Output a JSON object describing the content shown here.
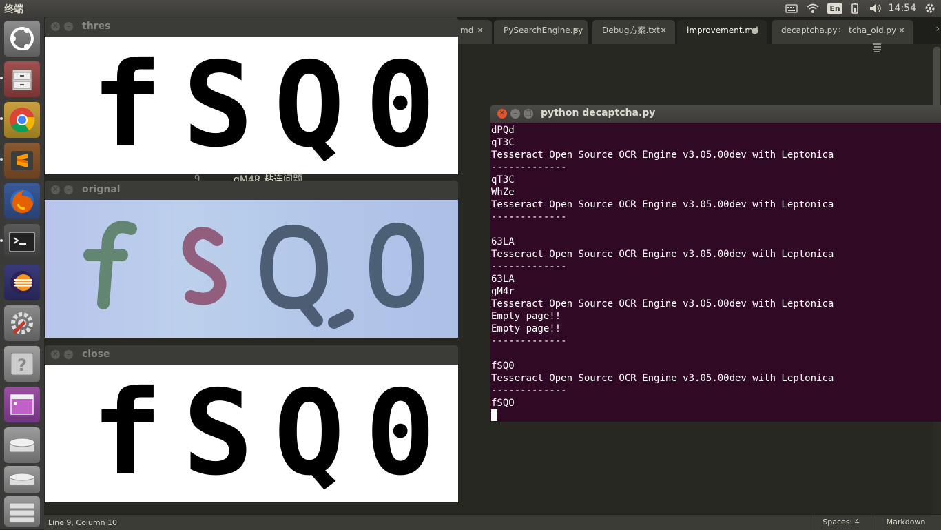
{
  "top_panel": {
    "app_title": "终端",
    "input_method": "En",
    "clock": "14:54",
    "icons": [
      "keyboard-icon",
      "wifi-icon",
      "battery-icon",
      "volume-icon",
      "gear-icon"
    ]
  },
  "launcher": {
    "items": [
      "dash-home",
      "files",
      "chrome",
      "sublime-text",
      "firefox",
      "terminal",
      "eclipse",
      "system-settings",
      "help",
      "workspace-switcher",
      "disk",
      "disk",
      "trash"
    ]
  },
  "editor": {
    "tabs": [
      {
        "label": "md",
        "close": "✕"
      },
      {
        "label": "PySearchEngine.py",
        "close": "✕"
      },
      {
        "label": "Debug方案.txt",
        "close": "✕"
      },
      {
        "label": "improvement.md",
        "close": "●"
      },
      {
        "label": "decaptcha.py",
        "close": "✕"
      },
      {
        "label": "tcha_old.py",
        "close": "✕"
      }
    ],
    "partial_line_number": "9",
    "partial_line_text": "gM4R 粘连问题",
    "status": {
      "position": "Line 9, Column 10",
      "indent": "Spaces: 4",
      "syntax": "Markdown"
    }
  },
  "windows": {
    "thres": {
      "title": "thres",
      "text": "fSQ0"
    },
    "orignal": {
      "title": "orignal",
      "text": "fSQ0"
    },
    "close": {
      "title": "close",
      "text": "fSQ0"
    }
  },
  "colors": {
    "glyph_f": "#527a5c",
    "glyph_s": "#8a4a6a",
    "glyph_q": "#3b4a5e",
    "glyph_0": "#3a4e60"
  },
  "terminal": {
    "title": "python decaptcha.py",
    "lines": [
      "dPQd",
      "qT3C",
      "Tesseract Open Source OCR Engine v3.05.00dev with Leptonica",
      "-------------",
      "qT3C",
      "WhZe",
      "Tesseract Open Source OCR Engine v3.05.00dev with Leptonica",
      "-------------",
      "",
      "63LA",
      "Tesseract Open Source OCR Engine v3.05.00dev with Leptonica",
      "-------------",
      "63LA",
      "gM4r",
      "Tesseract Open Source OCR Engine v3.05.00dev with Leptonica",
      "Empty page!!",
      "Empty page!!",
      "-------------",
      "",
      "fSQ0",
      "Tesseract Open Source OCR Engine v3.05.00dev with Leptonica",
      "-------------",
      "fSQO"
    ]
  }
}
